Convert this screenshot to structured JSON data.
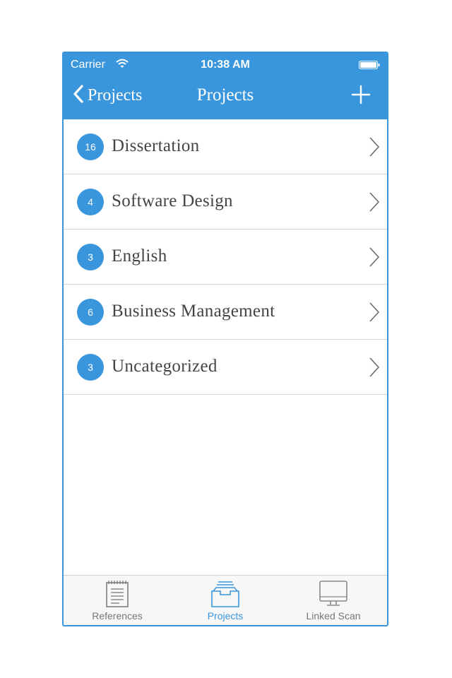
{
  "status_bar": {
    "carrier": "Carrier",
    "time": "10:38 AM"
  },
  "nav": {
    "back_label": "Projects",
    "title": "Projects"
  },
  "projects": [
    {
      "count": "16",
      "name": "Dissertation"
    },
    {
      "count": "4",
      "name": "Software Design"
    },
    {
      "count": "3",
      "name": "English"
    },
    {
      "count": "6",
      "name": "Business Management"
    },
    {
      "count": "3",
      "name": "Uncategorized"
    }
  ],
  "tabs": [
    {
      "label": "References",
      "icon": "notepad-icon",
      "active": false
    },
    {
      "label": "Projects",
      "icon": "inbox-tray-icon",
      "active": true
    },
    {
      "label": "Linked Scan",
      "icon": "monitor-icon",
      "active": false
    }
  ],
  "colors": {
    "accent": "#3a96dc",
    "text": "#444444",
    "inactive_tab": "#777777"
  }
}
